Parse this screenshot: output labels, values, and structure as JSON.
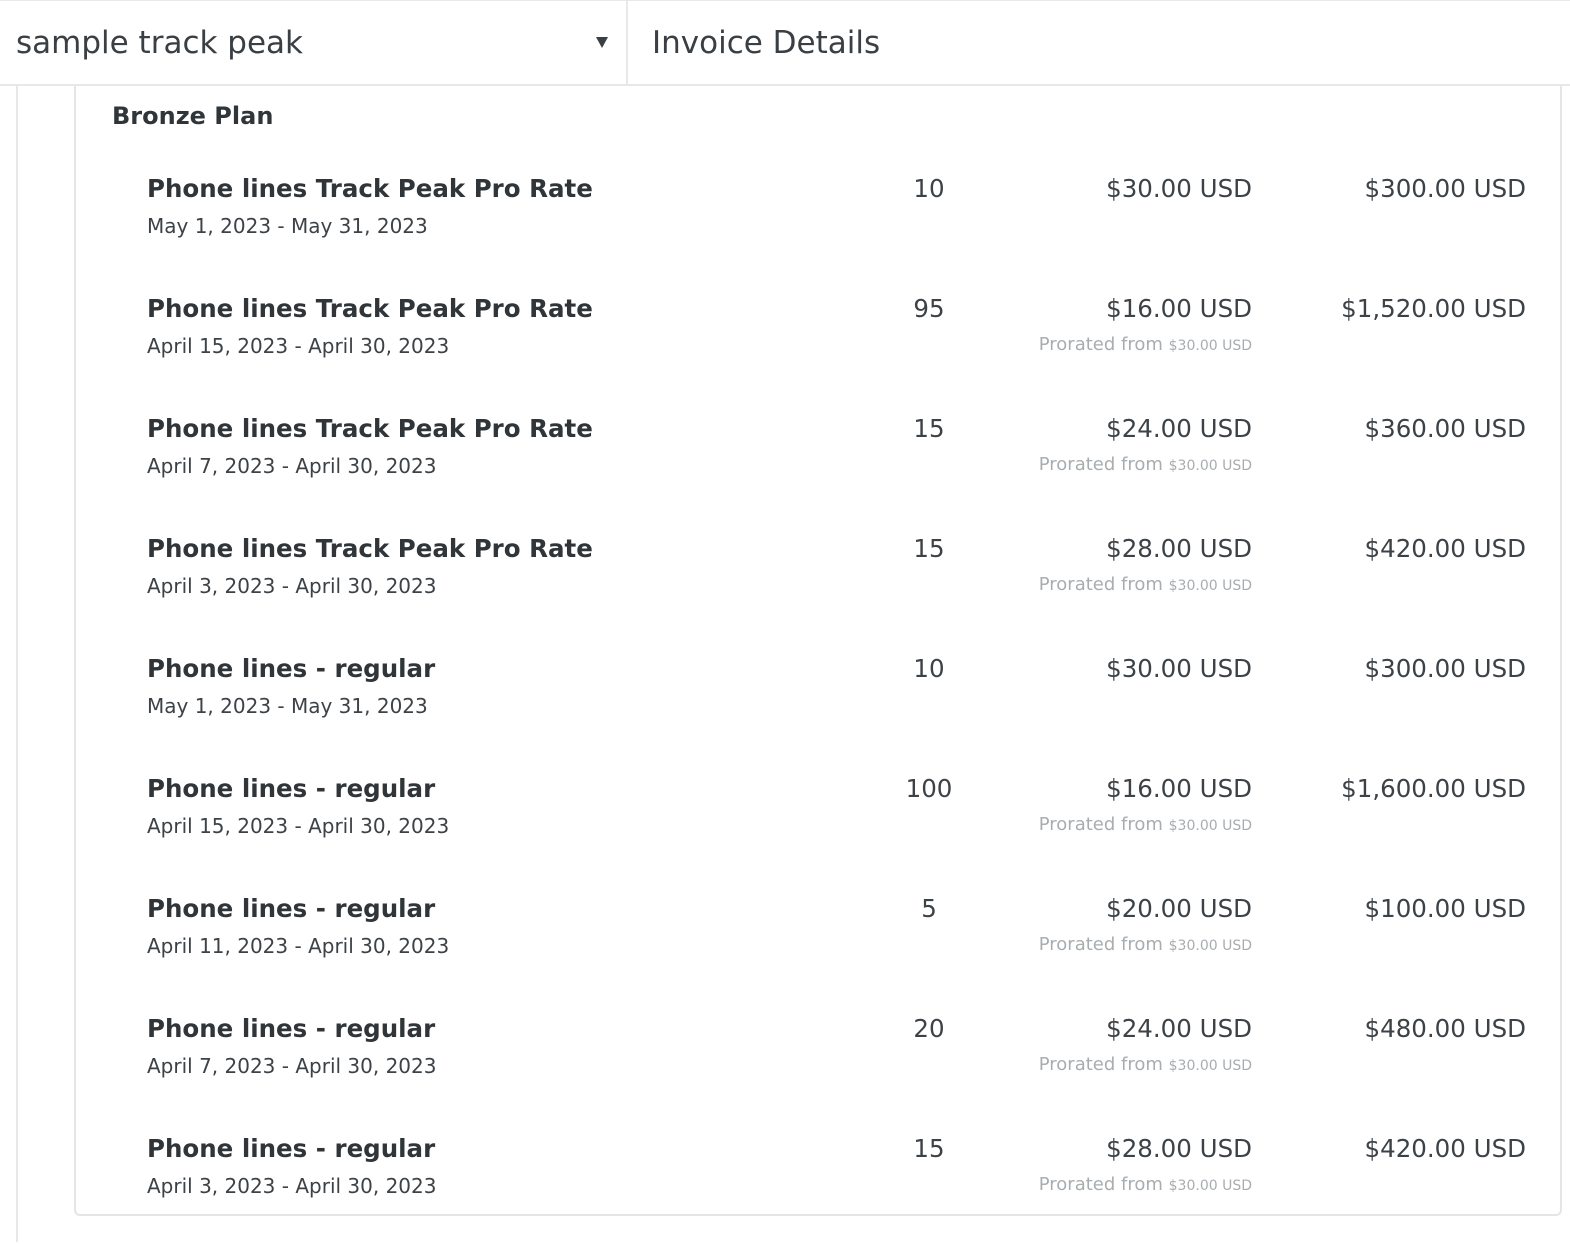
{
  "header": {
    "account_select": {
      "value": "sample track peak"
    },
    "title": "Invoice Details"
  },
  "plan": {
    "title": "Bronze Plan",
    "prorated_label": "Prorated from",
    "items": [
      {
        "name": "Phone lines Track Peak Pro Rate",
        "period": "May 1, 2023 - May 31, 2023",
        "quantity": "10",
        "unit_price": "$30.00 USD",
        "prorated_from": "",
        "amount": "$300.00 USD"
      },
      {
        "name": "Phone lines Track Peak Pro Rate",
        "period": "April 15, 2023 - April 30, 2023",
        "quantity": "95",
        "unit_price": "$16.00 USD",
        "prorated_from": "$30.00 USD",
        "amount": "$1,520.00 USD"
      },
      {
        "name": "Phone lines Track Peak Pro Rate",
        "period": "April 7, 2023 - April 30, 2023",
        "quantity": "15",
        "unit_price": "$24.00 USD",
        "prorated_from": "$30.00 USD",
        "amount": "$360.00 USD"
      },
      {
        "name": "Phone lines Track Peak Pro Rate",
        "period": "April 3, 2023 - April 30, 2023",
        "quantity": "15",
        "unit_price": "$28.00 USD",
        "prorated_from": "$30.00 USD",
        "amount": "$420.00 USD"
      },
      {
        "name": "Phone lines - regular",
        "period": "May 1, 2023 - May 31, 2023",
        "quantity": "10",
        "unit_price": "$30.00 USD",
        "prorated_from": "",
        "amount": "$300.00 USD"
      },
      {
        "name": "Phone lines - regular",
        "period": "April 15, 2023 - April 30, 2023",
        "quantity": "100",
        "unit_price": "$16.00 USD",
        "prorated_from": "$30.00 USD",
        "amount": "$1,600.00 USD"
      },
      {
        "name": "Phone lines - regular",
        "period": "April 11, 2023 - April 30, 2023",
        "quantity": "5",
        "unit_price": "$20.00 USD",
        "prorated_from": "$30.00 USD",
        "amount": "$100.00 USD"
      },
      {
        "name": "Phone lines - regular",
        "period": "April 7, 2023 - April 30, 2023",
        "quantity": "20",
        "unit_price": "$24.00 USD",
        "prorated_from": "$30.00 USD",
        "amount": "$480.00 USD"
      },
      {
        "name": "Phone lines - regular",
        "period": "April 3, 2023 - April 30, 2023",
        "quantity": "15",
        "unit_price": "$28.00 USD",
        "prorated_from": "$30.00 USD",
        "amount": "$420.00 USD"
      }
    ]
  }
}
